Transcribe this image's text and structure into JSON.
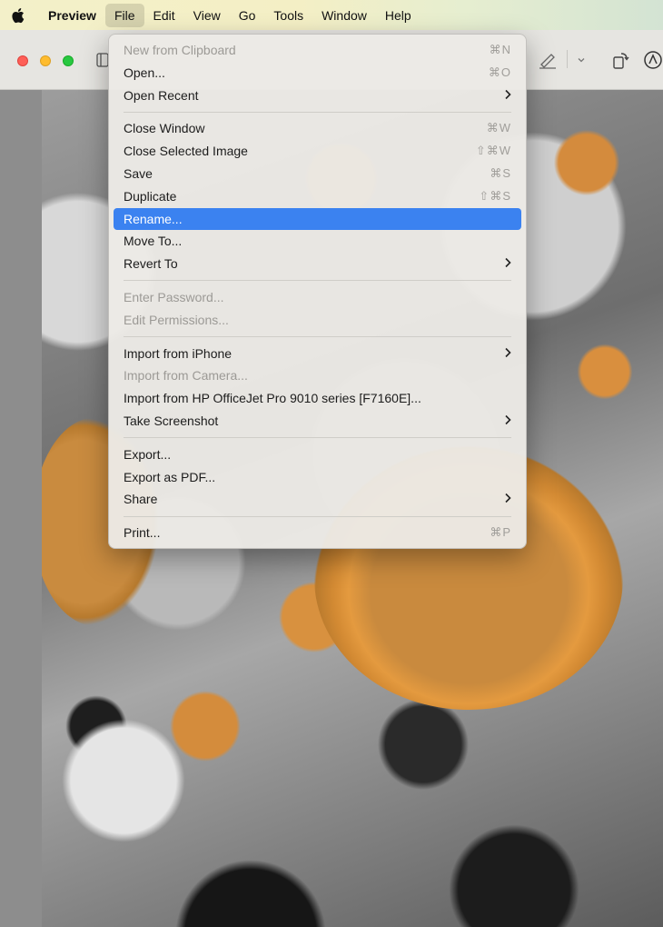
{
  "menubar": {
    "app_name": "Preview",
    "items": [
      "File",
      "Edit",
      "View",
      "Go",
      "Tools",
      "Window",
      "Help"
    ]
  },
  "file_menu": {
    "new_from_clipboard": {
      "label": "New from Clipboard",
      "shortcut": "⌘N"
    },
    "open": {
      "label": "Open...",
      "shortcut": "⌘O"
    },
    "open_recent": {
      "label": "Open Recent"
    },
    "close_window": {
      "label": "Close Window",
      "shortcut": "⌘W"
    },
    "close_selected_image": {
      "label": "Close Selected Image",
      "shortcut": "⇧⌘W"
    },
    "save": {
      "label": "Save",
      "shortcut": "⌘S"
    },
    "duplicate": {
      "label": "Duplicate",
      "shortcut": "⇧⌘S"
    },
    "rename": {
      "label": "Rename..."
    },
    "move_to": {
      "label": "Move To..."
    },
    "revert_to": {
      "label": "Revert To"
    },
    "enter_password": {
      "label": "Enter Password..."
    },
    "edit_permissions": {
      "label": "Edit Permissions..."
    },
    "import_from_iphone": {
      "label": "Import from iPhone"
    },
    "import_from_camera": {
      "label": "Import from Camera..."
    },
    "import_from_hp": {
      "label": "Import from HP OfficeJet Pro 9010 series [F7160E]..."
    },
    "take_screenshot": {
      "label": "Take Screenshot"
    },
    "export": {
      "label": "Export..."
    },
    "export_as_pdf": {
      "label": "Export as PDF..."
    },
    "share": {
      "label": "Share"
    },
    "print": {
      "label": "Print...",
      "shortcut": "⌘P"
    }
  },
  "colors": {
    "highlight": "#3b82f0",
    "close": "#fe5f57",
    "minimize": "#febc2e",
    "maximize": "#28c840"
  },
  "icons": [
    "apple-logo-icon",
    "sidebar-toggle-icon",
    "markup-pen-icon",
    "chevron-down-icon",
    "rotate-icon",
    "markup-circle-icon",
    "submenu-chevron-icon"
  ]
}
